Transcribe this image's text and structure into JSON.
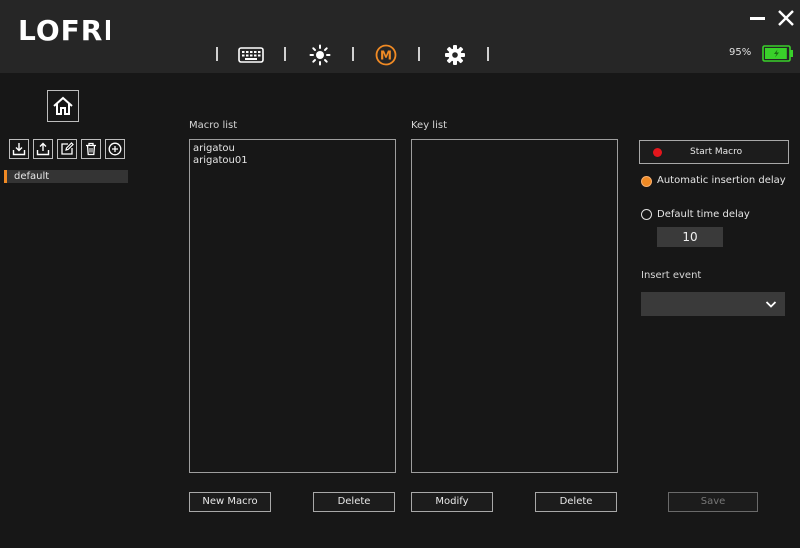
{
  "header": {
    "logo": "LOFREE",
    "battery_percent": "95%",
    "battery_level": 0.95,
    "nav": [
      {
        "icon": "keyboard-icon",
        "active": false
      },
      {
        "icon": "brightness-icon",
        "active": false
      },
      {
        "icon": "macro-icon",
        "active": true,
        "glyph": "M"
      },
      {
        "icon": "gear-icon",
        "active": false
      }
    ],
    "accent_color": "#f08a24",
    "battery_color": "#39d12a"
  },
  "sidebar": {
    "tools": [
      "import-icon",
      "export-icon",
      "edit-icon",
      "trash-icon",
      "add-icon"
    ],
    "profiles": [
      "default"
    ]
  },
  "macro_panel": {
    "macro_list_label": "Macro list",
    "macros": [
      "arigatou",
      "arigatou01"
    ],
    "key_list_label": "Key list",
    "keys": [],
    "new_macro_label": "New Macro",
    "delete_macro_label": "Delete",
    "modify_label": "Modify",
    "delete_key_label": "Delete"
  },
  "settings": {
    "start_macro_label": "Start Macro",
    "auto_delay_label": "Automatic insertion delay",
    "auto_delay_selected": true,
    "default_delay_label": "Default time delay",
    "default_delay_value": "10",
    "insert_event_label": "Insert event",
    "insert_event_value": "",
    "save_label": "Save",
    "record_color": "#e3161c"
  }
}
